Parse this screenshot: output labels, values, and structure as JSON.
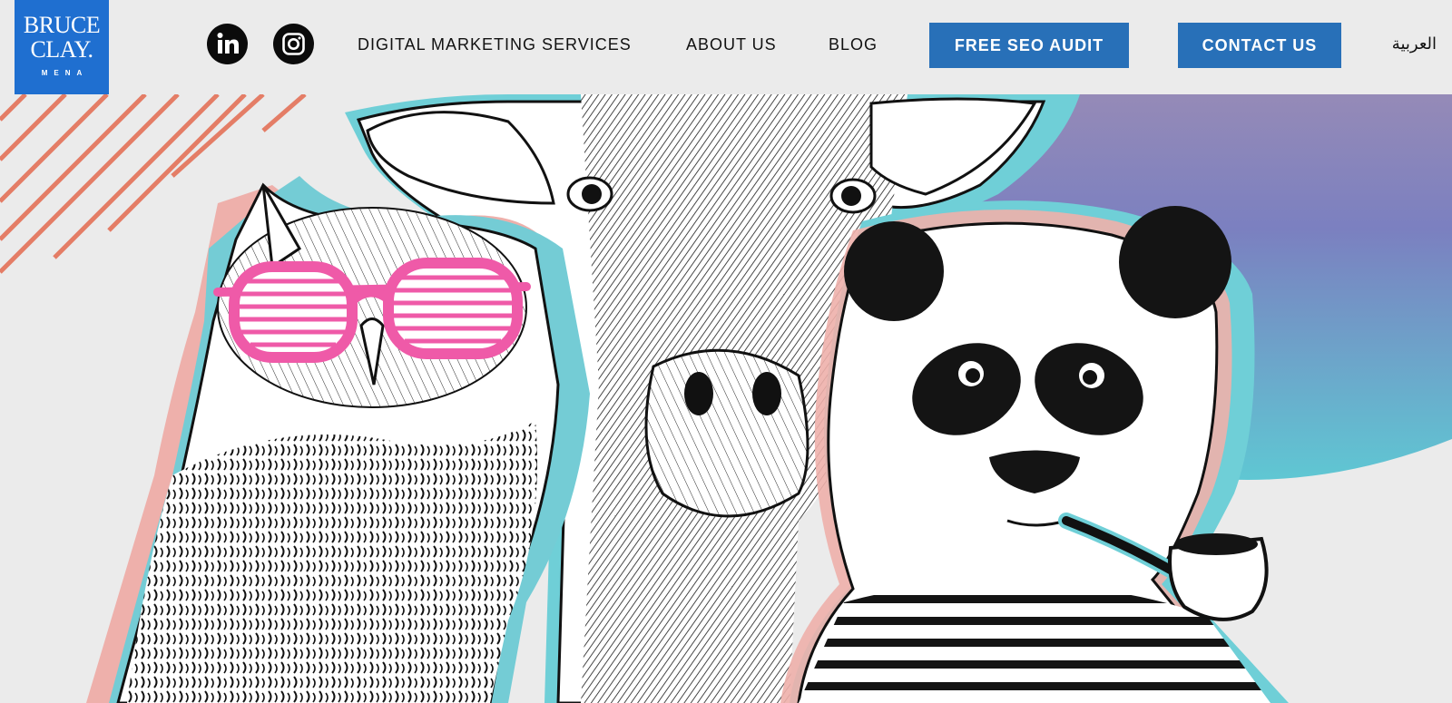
{
  "brand": {
    "line1": "Bruce",
    "line2": "Clay.",
    "line3": "MENA",
    "logo_color": "#1f6fd0"
  },
  "social": [
    {
      "name": "linkedin",
      "icon": "linkedin-icon"
    },
    {
      "name": "instagram",
      "icon": "instagram-icon"
    }
  ],
  "nav": {
    "services": "DIGITAL MARKETING SERVICES",
    "about": "ABOUT US",
    "blog": "BLOG",
    "audit": "FREE SEO AUDIT",
    "contact": "CONTACT US",
    "language": "العربية"
  },
  "colors": {
    "button_bg": "#2870b8",
    "button_text": "#ffffff",
    "page_bg": "#ebebeb",
    "accent_stripes": "#e47d66",
    "glasses": "#ef5aa8",
    "gradient_top": "#8f85b9",
    "gradient_bottom": "#62c9d4"
  },
  "hero": {
    "illustration": [
      "owl-with-pink-shutter-glasses",
      "giraffe",
      "panda-with-pipe"
    ]
  }
}
